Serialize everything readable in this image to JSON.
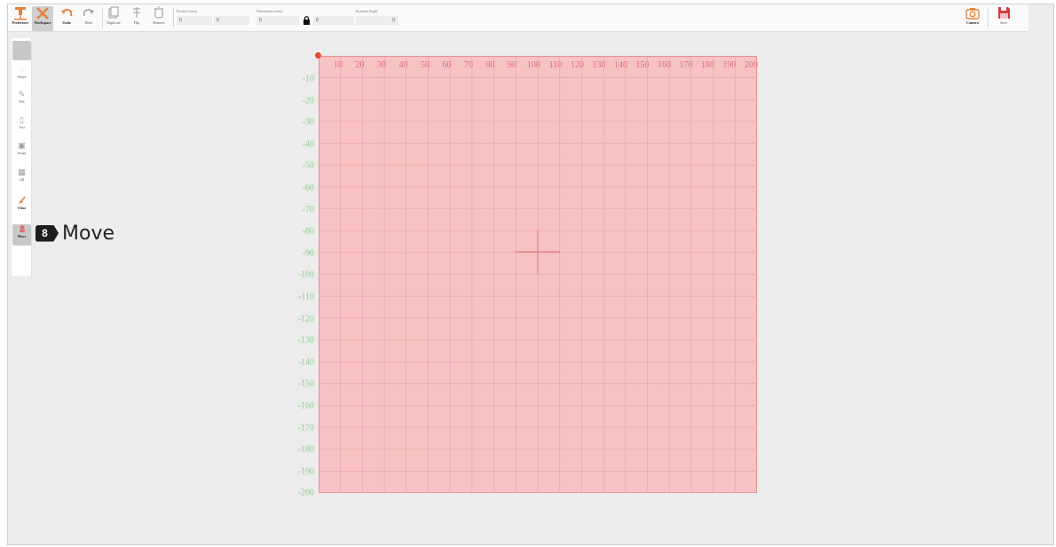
{
  "toolbar": {
    "tools": [
      {
        "label": "Preference",
        "icon": "laser-engraver-icon"
      },
      {
        "label": "Workspace",
        "icon": "crossed-tools-icon"
      },
      {
        "label": "Undo",
        "icon": "undo-icon"
      },
      {
        "label": "Redo",
        "icon": "redo-icon"
      },
      {
        "label": "Duplicate",
        "icon": "duplicate-icon"
      },
      {
        "label": "Flip",
        "icon": "flip-icon"
      },
      {
        "label": "Remove",
        "icon": "remove-icon"
      }
    ],
    "position": {
      "label": "Position (mm)",
      "x": "0",
      "y": "0"
    },
    "dimensions": {
      "label": "Dimensions (mm)",
      "w": "0",
      "h": "0"
    },
    "rotation": {
      "label": "Rotation Angle",
      "value": "0"
    },
    "camera_label": "Camera",
    "save_label": "Save"
  },
  "left_panel": {
    "items": [
      {
        "label": "",
        "icon": "select-icon"
      },
      {
        "label": "Shape",
        "icon": "shape-icon"
      },
      {
        "label": "Pen",
        "icon": "pen-icon"
      },
      {
        "label": "Text",
        "icon": "text-icon"
      },
      {
        "label": "Image",
        "icon": "image-icon"
      },
      {
        "label": "QR",
        "icon": "qr-code-icon"
      },
      {
        "label": "Clear",
        "icon": "clear-icon"
      },
      {
        "label": "Move",
        "icon": "move-icon"
      }
    ]
  },
  "callout": {
    "number": "8",
    "text": "Move"
  },
  "canvas": {
    "x_ticks": [
      "10",
      "20",
      "30",
      "40",
      "50",
      "60",
      "70",
      "80",
      "90",
      "100",
      "110",
      "120",
      "130",
      "140",
      "150",
      "160",
      "170",
      "180",
      "190",
      "200"
    ],
    "y_ticks": [
      "-10",
      "-20",
      "-30",
      "-40",
      "-50",
      "-60",
      "-70",
      "-80",
      "-90",
      "-100",
      "-110",
      "-120",
      "-130",
      "-140",
      "-150",
      "-160",
      "-170",
      "-180",
      "-190",
      "-200"
    ],
    "work_area_color": "#f7c2c4",
    "x_tick_color": "#e06f75",
    "y_tick_color": "#8fce8b"
  }
}
